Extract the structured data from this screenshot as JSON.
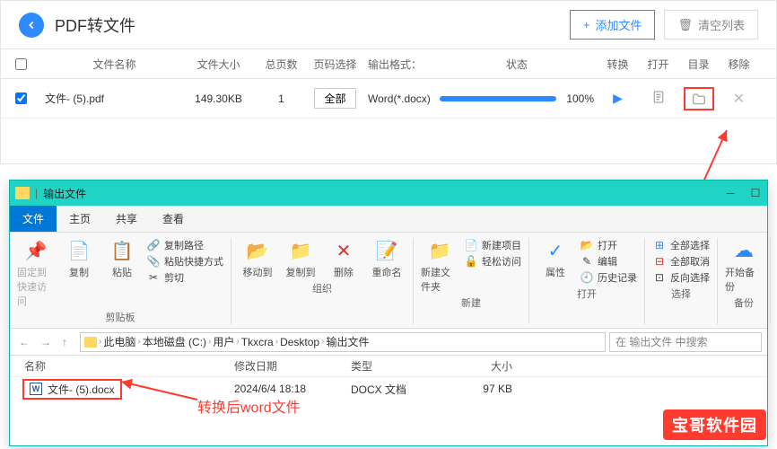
{
  "converter": {
    "title": "PDF转文件",
    "add_btn": "添加文件",
    "clear_btn": "清空列表",
    "headers": {
      "name": "文件名称",
      "size": "文件大小",
      "pages": "总页数",
      "select": "页码选择",
      "format": "输出格式：",
      "status": "状态",
      "convert": "转换",
      "open": "打开",
      "dir": "目录",
      "remove": "移除"
    },
    "row": {
      "name": "文件- (5).pdf",
      "size": "149.30KB",
      "pages": "1",
      "select_btn": "全部",
      "format": "Word(*.docx)",
      "percent": "100%"
    }
  },
  "explorer": {
    "window_title": "输出文件",
    "tabs": {
      "file": "文件",
      "home": "主页",
      "share": "共享",
      "view": "查看"
    },
    "ribbon": {
      "pin": "固定到快速访问",
      "copy": "复制",
      "paste": "粘贴",
      "copy_path": "复制路径",
      "paste_shortcut": "粘贴快捷方式",
      "cut": "剪切",
      "clipboard": "剪贴板",
      "move_to": "移动到",
      "copy_to": "复制到",
      "delete": "删除",
      "rename": "重命名",
      "organize": "组织",
      "new_folder": "新建文件夹",
      "new_item": "新建项目",
      "easy_access": "轻松访问",
      "new": "新建",
      "properties": "属性",
      "open": "打开",
      "edit": "编辑",
      "history": "历史记录",
      "open_group": "打开",
      "select_all": "全部选择",
      "select_none": "全部取消",
      "invert": "反向选择",
      "select": "选择",
      "backup": "开始备份",
      "backup_group": "备份"
    },
    "breadcrumbs": [
      "此电脑",
      "本地磁盘 (C:)",
      "用户",
      "Tkxcra",
      "Desktop",
      "输出文件"
    ],
    "search_placeholder": "在 输出文件 中搜索",
    "columns": {
      "name": "名称",
      "date": "修改日期",
      "type": "类型",
      "size": "大小"
    },
    "file": {
      "name": "文件- (5).docx",
      "date": "2024/6/4 18:18",
      "type": "DOCX 文档",
      "size": "97 KB"
    }
  },
  "annotation": {
    "text": "转换后word文件"
  },
  "watermark": "宝哥软件园"
}
